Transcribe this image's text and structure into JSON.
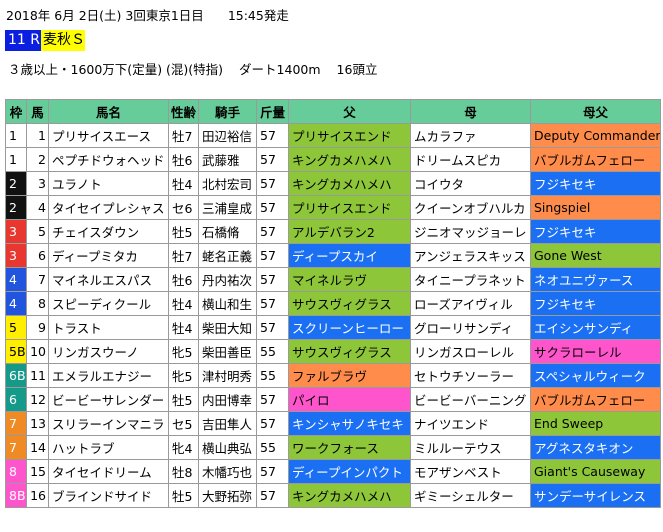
{
  "race": {
    "date_line": "2018年 6月 2日(土) 3回東京1日目",
    "start_time": "15:45発走",
    "race_number": "11 R",
    "race_name": "麦秋Ｓ",
    "conditions": "３歳以上・1600万下(定量) (混)(特指)",
    "course": "ダート1400m",
    "runners": "16頭立"
  },
  "columns": [
    "枠",
    "馬",
    "馬名",
    "性齢",
    "騎手",
    "斤量",
    "父",
    "母",
    "母父"
  ],
  "palette": {
    "green": "#8ec63a",
    "blue": "#1a6ff2",
    "orange": "#ff8c4a",
    "pink": "#ff55cc",
    "header": "#66cc99"
  },
  "gate_colors": {
    "1": {
      "bg": "#ffffff",
      "fg": "#000000"
    },
    "2": {
      "bg": "#111111",
      "fg": "#ffffff"
    },
    "3": {
      "bg": "#e8372e",
      "fg": "#ffffff"
    },
    "4": {
      "bg": "#2255dd",
      "fg": "#ffffff"
    },
    "5": {
      "bg": "#ffee00",
      "fg": "#000000"
    },
    "6": {
      "bg": "#159a8a",
      "fg": "#ffffff"
    },
    "7": {
      "bg": "#f08a24",
      "fg": "#ffffff"
    },
    "8": {
      "bg": "#ff55cc",
      "fg": "#ffffff"
    }
  },
  "entries": [
    {
      "waku": "1",
      "umaban": "1",
      "name": "プリサイスエース",
      "sex_age": "牡7",
      "jockey": "田辺裕信",
      "weight": "57",
      "sire": "プリサイスエンド",
      "sire_color": "green",
      "dam": "ムカラファ",
      "damsire": "Deputy Commander",
      "damsire_color": "orange"
    },
    {
      "waku": "1",
      "umaban": "2",
      "name": "ペプチドウォヘッド",
      "sex_age": "牡6",
      "jockey": "武藤雅",
      "weight": "57",
      "sire": "キングカメハメハ",
      "sire_color": "green",
      "dam": "ドリームスピカ",
      "damsire": "バブルガムフェロー",
      "damsire_color": "orange"
    },
    {
      "waku": "2",
      "umaban": "3",
      "name": "ユラノト",
      "sex_age": "牡4",
      "jockey": "北村宏司",
      "weight": "57",
      "sire": "キングカメハメハ",
      "sire_color": "green",
      "dam": "コイウタ",
      "damsire": "フジキセキ",
      "damsire_color": "blue"
    },
    {
      "waku": "2",
      "umaban": "4",
      "name": "タイセイプレシャス",
      "sex_age": "セ6",
      "jockey": "三浦皇成",
      "weight": "57",
      "sire": "プリサイスエンド",
      "sire_color": "green",
      "dam": "クイーンオブハルカ",
      "damsire": "Singspiel",
      "damsire_color": "orange"
    },
    {
      "waku": "3",
      "umaban": "5",
      "name": "チェイスダウン",
      "sex_age": "牡5",
      "jockey": "石橋脩",
      "weight": "57",
      "sire": "アルデバラン2",
      "sire_color": "green",
      "dam": "ジニオマッジョーレ",
      "damsire": "フジキセキ",
      "damsire_color": "blue"
    },
    {
      "waku": "3",
      "umaban": "6",
      "name": "ディープミタカ",
      "sex_age": "牡7",
      "jockey": "蛯名正義",
      "weight": "57",
      "sire": "ディープスカイ",
      "sire_color": "blue",
      "dam": "アンジェラスキッス",
      "damsire": "Gone West",
      "damsire_color": "green"
    },
    {
      "waku": "4",
      "umaban": "7",
      "name": "マイネルエスパス",
      "sex_age": "牡6",
      "jockey": "丹内祐次",
      "weight": "57",
      "sire": "マイネルラヴ",
      "sire_color": "green",
      "dam": "タイニープラネット",
      "damsire": "ネオユニヴァース",
      "damsire_color": "blue"
    },
    {
      "waku": "4",
      "umaban": "8",
      "name": "スピーディクール",
      "sex_age": "牡4",
      "jockey": "横山和生",
      "weight": "57",
      "sire": "サウスヴィグラス",
      "sire_color": "green",
      "dam": "ローズアイヴィル",
      "damsire": "フジキセキ",
      "damsire_color": "blue"
    },
    {
      "waku": "5",
      "umaban": "9",
      "name": "トラスト",
      "sex_age": "牡4",
      "jockey": "柴田大知",
      "weight": "57",
      "sire": "スクリーンヒーロー",
      "sire_color": "blue",
      "dam": "グローリサンディ",
      "damsire": "エイシンサンディ",
      "damsire_color": "blue"
    },
    {
      "waku": "5B",
      "umaban": "10",
      "name": "リンガスウーノ",
      "sex_age": "牝5",
      "jockey": "柴田善臣",
      "weight": "55",
      "sire": "サウスヴィグラス",
      "sire_color": "green",
      "dam": "リンガスローレル",
      "damsire": "サクラローレル",
      "damsire_color": "pink"
    },
    {
      "waku": "6B",
      "umaban": "11",
      "name": "エメラルエナジー",
      "sex_age": "牝5",
      "jockey": "津村明秀",
      "weight": "55",
      "sire": "ファルブラヴ",
      "sire_color": "orange",
      "dam": "セトウチソーラー",
      "damsire": "スペシャルウィーク",
      "damsire_color": "blue"
    },
    {
      "waku": "6",
      "umaban": "12",
      "name": "ビービーサレンダー",
      "sex_age": "牡5",
      "jockey": "内田博幸",
      "weight": "57",
      "sire": "パイロ",
      "sire_color": "pink",
      "dam": "ビービーバーニング",
      "damsire": "バブルガムフェロー",
      "damsire_color": "orange"
    },
    {
      "waku": "7",
      "umaban": "13",
      "name": "スリラーインマニラ",
      "sex_age": "セ5",
      "jockey": "吉田隼人",
      "weight": "57",
      "sire": "キンシャサノキセキ",
      "sire_color": "blue",
      "dam": "ナイツエンド",
      "damsire": "End Sweep",
      "damsire_color": "green"
    },
    {
      "waku": "7",
      "umaban": "14",
      "name": "ハットラブ",
      "sex_age": "牝4",
      "jockey": "横山典弘",
      "weight": "55",
      "sire": "ワークフォース",
      "sire_color": "green",
      "dam": "ミルルーテウス",
      "damsire": "アグネスタキオン",
      "damsire_color": "blue"
    },
    {
      "waku": "8",
      "umaban": "15",
      "name": "タイセイドリーム",
      "sex_age": "牡8",
      "jockey": "木幡巧也",
      "weight": "57",
      "sire": "ディープインパクト",
      "sire_color": "blue",
      "dam": "モアザンベスト",
      "damsire": "Giant's Causeway",
      "damsire_color": "green"
    },
    {
      "waku": "8B",
      "umaban": "16",
      "name": "ブラインドサイド",
      "sex_age": "牡5",
      "jockey": "大野拓弥",
      "weight": "57",
      "sire": "キングカメハメハ",
      "sire_color": "green",
      "dam": "ギミーシェルター",
      "damsire": "サンデーサイレンス",
      "damsire_color": "blue"
    }
  ]
}
